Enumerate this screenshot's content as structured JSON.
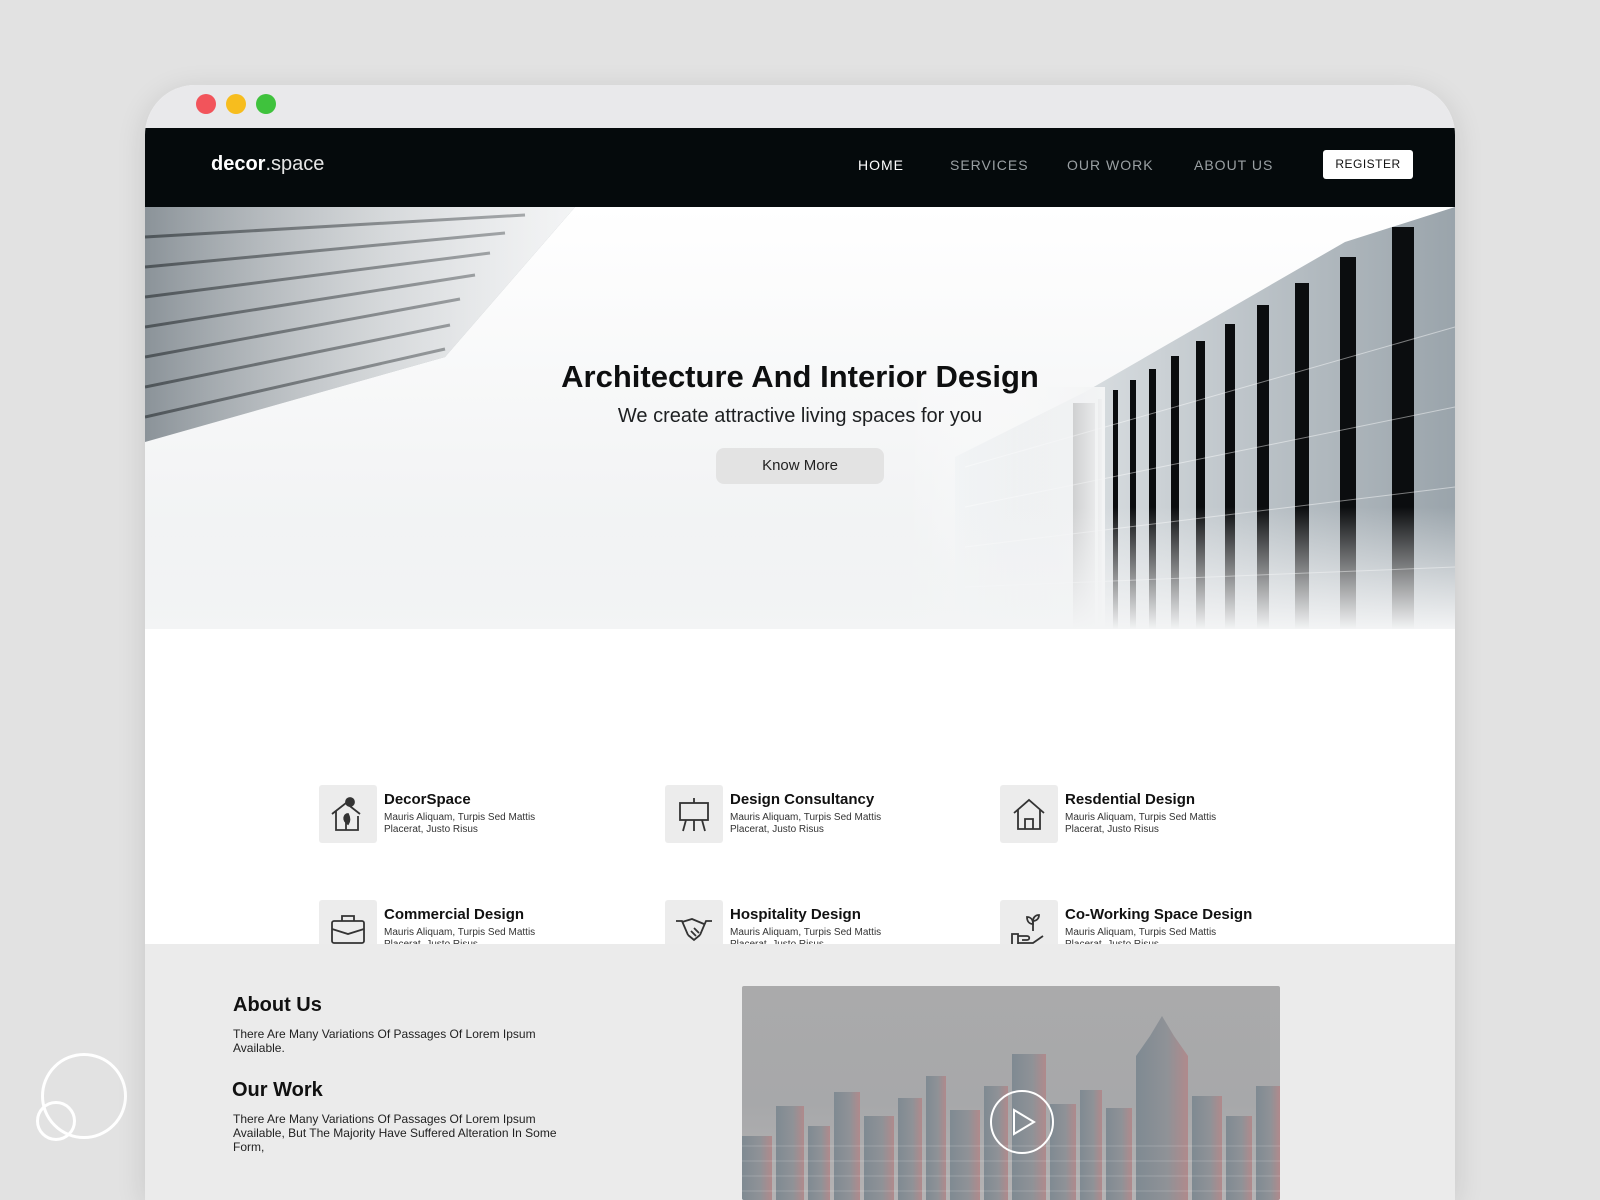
{
  "brand": {
    "bold": "decor",
    "dot": ".",
    "rest": "space"
  },
  "nav": {
    "home": "HOME",
    "services": "SERVICES",
    "our_work": "OUR WORK",
    "about_us": "ABOUT US",
    "register": "REGISTER"
  },
  "hero": {
    "title": "Architecture And Interior Design",
    "subtitle": "We create attractive living spaces for you",
    "button": "Know More"
  },
  "services": [
    {
      "title": "DecorSpace",
      "desc": "Mauris Aliquam, Turpis Sed Mattis Placerat, Justo Risus",
      "icon": "house-plant-icon"
    },
    {
      "title": "Design Consultancy",
      "desc": "Mauris Aliquam, Turpis Sed Mattis Placerat, Justo Risus",
      "icon": "easel-icon"
    },
    {
      "title": "Resdential Design",
      "desc": "Mauris Aliquam, Turpis Sed Mattis Placerat, Justo Risus",
      "icon": "home-icon"
    },
    {
      "title": "Commercial Design",
      "desc": "Mauris Aliquam, Turpis Sed Mattis Placerat, Justo Risus",
      "icon": "briefcase-icon"
    },
    {
      "title": "Hospitality Design",
      "desc": "Mauris Aliquam, Turpis Sed Mattis Placerat, Justo Risus",
      "icon": "handshake-icon"
    },
    {
      "title": "Co-Working Space Design",
      "desc": "Mauris Aliquam, Turpis Sed Mattis Placerat, Justo Risus",
      "icon": "hand-sprout-icon"
    }
  ],
  "about": {
    "title": "About Us",
    "text": "There Are Many Variations Of Passages Of Lorem Ipsum Available."
  },
  "work": {
    "title": "Our Work",
    "text": "There Are Many Variations Of Passages Of Lorem Ipsum Available, But The Majority Have Suffered Alteration In Some Form,"
  },
  "video": {
    "play_icon": "play-icon"
  },
  "colors": {
    "navbar": "#050a0c",
    "background": "#e2e2e2",
    "window_dots": [
      "#f2545b",
      "#f7bd1e",
      "#3fc23d"
    ]
  }
}
